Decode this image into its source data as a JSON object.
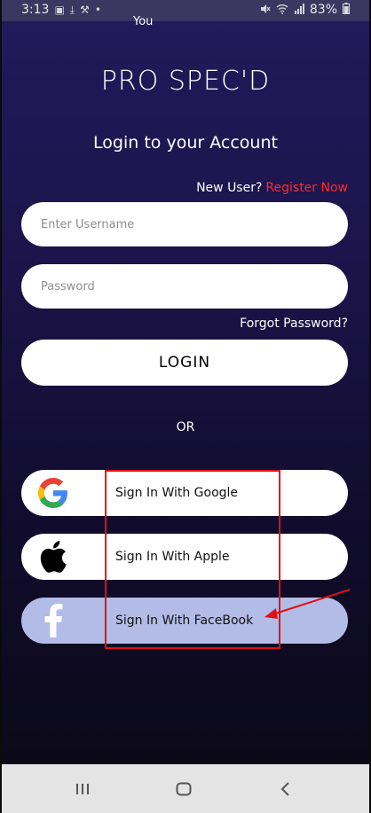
{
  "status_bar": {
    "time": "3:13",
    "battery": "83%",
    "left_icons": [
      "gallery-icon",
      "download-icon",
      "tools-icon",
      "dot-icon"
    ],
    "right_icons": [
      "mute-icon",
      "wifi-icon",
      "signal-icon",
      "battery-icon"
    ]
  },
  "overlay": {
    "label": "You"
  },
  "app": {
    "title": "PRO SPEC'D",
    "subtitle": "Login to your Account",
    "new_user_text": "New User?",
    "register_label": "Register Now"
  },
  "form": {
    "username_placeholder": "Enter Username",
    "password_placeholder": "Password",
    "forgot_label": "Forgot Password?",
    "login_label": "LOGIN",
    "or_label": "OR"
  },
  "social": [
    {
      "label": "Sign In With Google",
      "icon": "google-icon"
    },
    {
      "label": "Sign In With Apple",
      "icon": "apple-icon"
    },
    {
      "label": "Sign In With FaceBook",
      "icon": "facebook-icon"
    }
  ],
  "colors": {
    "accent_red": "#ff2a2a",
    "background_top": "#221a5c",
    "facebook_button": "#b3bce6"
  },
  "nav_bar": {
    "buttons": [
      "recents-icon",
      "home-icon",
      "back-icon"
    ]
  }
}
